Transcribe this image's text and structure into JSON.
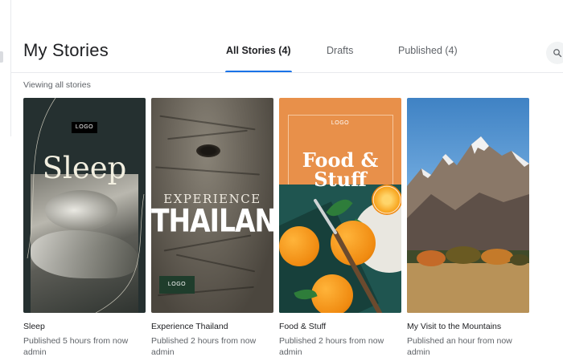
{
  "header": {
    "title": "My Stories",
    "tabs": [
      {
        "label": "All Stories (4)",
        "active": true
      },
      {
        "label": "Drafts",
        "active": false
      },
      {
        "label": "Published (4)",
        "active": false
      }
    ],
    "search_icon": "search-icon"
  },
  "filter_label": "Viewing all stories",
  "accent_color": "#1a73e8",
  "stories": [
    {
      "title": "Sleep",
      "meta": "Published 5 hours from now",
      "author": "admin",
      "thumb_title": "Sleep",
      "thumb_logo": "LOGO"
    },
    {
      "title": "Experience Thailand",
      "meta": "Published 2 hours from now",
      "author": "admin",
      "thumb_pretitle": "EXPERIENCE",
      "thumb_title": "THAILAND",
      "thumb_logo": "LOGO"
    },
    {
      "title": "Food & Stuff",
      "meta": "Published 2 hours from now",
      "author": "admin",
      "thumb_title_line1": "Food &",
      "thumb_title_line2": "Stuff",
      "thumb_logo": "LOGO"
    },
    {
      "title": "My Visit to the Mountains",
      "meta": "Published an hour from now",
      "author": "admin"
    }
  ]
}
